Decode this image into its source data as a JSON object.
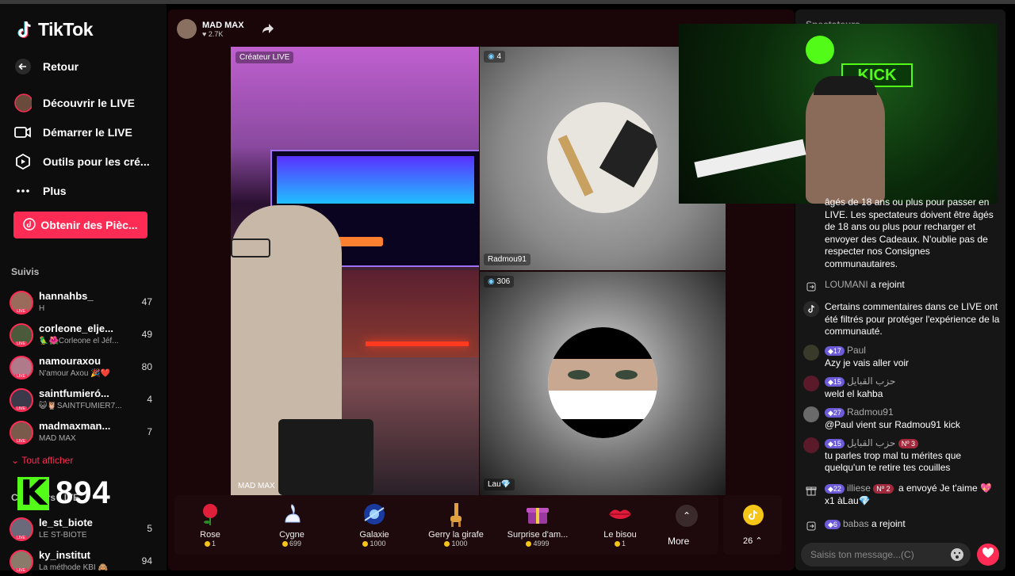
{
  "app": {
    "name": "TikTok"
  },
  "nav": {
    "back": "Retour",
    "items": [
      "Découvrir le LIVE",
      "Démarrer le LIVE",
      "Outils pour les cré...",
      "Plus"
    ],
    "coins_button": "Obtenir des Pièc..."
  },
  "following": {
    "title": "Suivis",
    "users": [
      {
        "name": "hannahbs_",
        "sub": "H",
        "count": "47"
      },
      {
        "name": "corleone_elje...",
        "sub": "🦜🌺Corleone el Jéf...",
        "count": "49"
      },
      {
        "name": "namouraxou",
        "sub": "N'amour Axou 🎉❤️",
        "count": "80"
      },
      {
        "name": "saintfumieró...",
        "sub": "😺🦉SAINTFUMIER7...",
        "count": "4"
      },
      {
        "name": "madmaxman...",
        "sub": "MAD MAX",
        "count": "7"
      }
    ],
    "show_all": "Tout afficher",
    "creators_title": "Créateurs LIVE",
    "creators": [
      {
        "name": "le_st_biote",
        "sub": "LE ST-BIOTE",
        "count": "5"
      },
      {
        "name": "ky_institut",
        "sub": "La méthode KBI 🙈",
        "count": "94"
      }
    ]
  },
  "kick_overlay": {
    "count": "894"
  },
  "host": {
    "name": "MAD MAX",
    "likes": "2.7K"
  },
  "tiles": {
    "main_label": "Créateur LIVE",
    "main_name": "MAD MAX",
    "t2_count": "4",
    "t2_name": "Radmou91",
    "t3_count": "306",
    "t3_name": "Lau💎"
  },
  "gifts": [
    {
      "name": "Rose",
      "price": "1"
    },
    {
      "name": "Cygne",
      "price": "699"
    },
    {
      "name": "Galaxie",
      "price": "1000"
    },
    {
      "name": "Gerry la girafe",
      "price": "1000"
    },
    {
      "name": "Surprise d'am...",
      "price": "4999"
    },
    {
      "name": "Le bisou",
      "price": "1"
    }
  ],
  "more_label": "More",
  "coins": {
    "count": "26"
  },
  "chat": {
    "header": "Spectateurs",
    "system_msg": "âgés de 18 ans ou plus pour passer en LIVE. Les spectateurs doivent être âgés de 18 ans ou plus pour recharger et envoyer des Cadeaux. N'oublie pas de respecter nos Consignes communautaires.",
    "join1_user": "LOUMANI",
    "joined": "a rejoint",
    "filter_msg": "Certains commentaires dans ce LIVE ont été filtrés pour protéger l'expérience de la communauté.",
    "m1_badge": "17",
    "m1_user": "Paul",
    "m1_text": "Azy je vais aller voir",
    "m2_badge": "15",
    "m2_user": "حزب القبايل",
    "m2_text": "weld el kahba",
    "m3_badge": "27",
    "m3_user": "Radmou91",
    "m3_text": "@Paul vient sur Radmou91 kick",
    "m4_badge": "15",
    "m4_user": "حزب القبايل",
    "m4_rank": "Nº 3",
    "m4_text": "tu parles trop mal tu mérites que quelqu'un te retire tes couilles",
    "gift_badge": "22",
    "gift_user": "illiese",
    "gift_rank": "Nº 2",
    "gift_text": "a envoyé Je t'aime 💖 x1 àLau💎",
    "join2_badge": "6",
    "join2_user": "babas",
    "input_placeholder": "Saisis ton message...(C)"
  },
  "colors": {
    "accent": "#fe2c55",
    "kick": "#53fc18",
    "badge": "#6b5bd6"
  }
}
